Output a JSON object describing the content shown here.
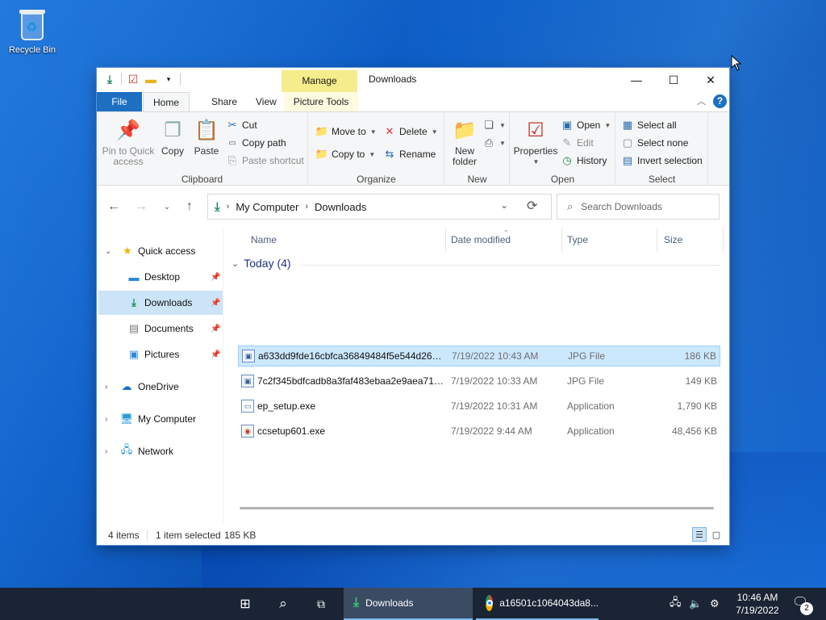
{
  "desktop": {
    "recycle_bin_label": "Recycle Bin"
  },
  "window": {
    "title": "Downloads",
    "contextual_tab_header": "Manage",
    "tabs": {
      "file": "File",
      "home": "Home",
      "share": "Share",
      "view": "View",
      "picture_tools": "Picture Tools"
    }
  },
  "ribbon": {
    "clipboard": {
      "label": "Clipboard",
      "pin_to_quick_access": [
        "Pin to Quick",
        "access"
      ],
      "copy": "Copy",
      "paste": "Paste",
      "cut": "Cut",
      "copy_path": "Copy path",
      "paste_shortcut": "Paste shortcut"
    },
    "organize": {
      "label": "Organize",
      "move_to": "Move to",
      "copy_to": "Copy to",
      "delete": "Delete",
      "rename": "Rename"
    },
    "new": {
      "label": "New",
      "new_folder": [
        "New",
        "folder"
      ]
    },
    "open": {
      "label": "Open",
      "properties": "Properties",
      "open": "Open",
      "edit": "Edit",
      "history": "History"
    },
    "select": {
      "label": "Select",
      "select_all": "Select all",
      "select_none": "Select none",
      "invert_selection": "Invert selection"
    }
  },
  "address": {
    "crumbs": [
      "My Computer",
      "Downloads"
    ],
    "search_placeholder": "Search Downloads"
  },
  "nav_pane": {
    "quick_access": "Quick access",
    "items": [
      "Desktop",
      "Downloads",
      "Documents",
      "Pictures"
    ],
    "onedrive": "OneDrive",
    "my_computer": "My Computer",
    "network": "Network"
  },
  "file_list": {
    "columns": {
      "name": "Name",
      "date": "Date modified",
      "type": "Type",
      "size": "Size"
    },
    "group": "Today (4)",
    "rows": [
      {
        "name": "a633dd9fde16cbfca36849484f5e544d2661...",
        "date": "7/19/2022 10:43 AM",
        "type": "JPG File",
        "size": "186 KB"
      },
      {
        "name": "7c2f345bdfcadb8a3faf483ebaa2e9aea712...",
        "date": "7/19/2022 10:33 AM",
        "type": "JPG File",
        "size": "149 KB"
      },
      {
        "name": "ep_setup.exe",
        "date": "7/19/2022 10:31 AM",
        "type": "Application",
        "size": "1,790 KB"
      },
      {
        "name": "ccsetup601.exe",
        "date": "7/19/2022 9:44 AM",
        "type": "Application",
        "size": "48,456 KB"
      }
    ]
  },
  "status": {
    "items": "4 items",
    "selected": "1 item selected",
    "size": "185 KB"
  },
  "taskbar": {
    "apps": [
      {
        "label": "Downloads"
      },
      {
        "label": "a16501c1064043da8..."
      }
    ],
    "time": "10:46 AM",
    "date": "7/19/2022",
    "notifications": "2"
  },
  "colors": {
    "accent": "#1d6fc2",
    "selection": "#cce8ff",
    "taskbar": "#1b2434"
  }
}
